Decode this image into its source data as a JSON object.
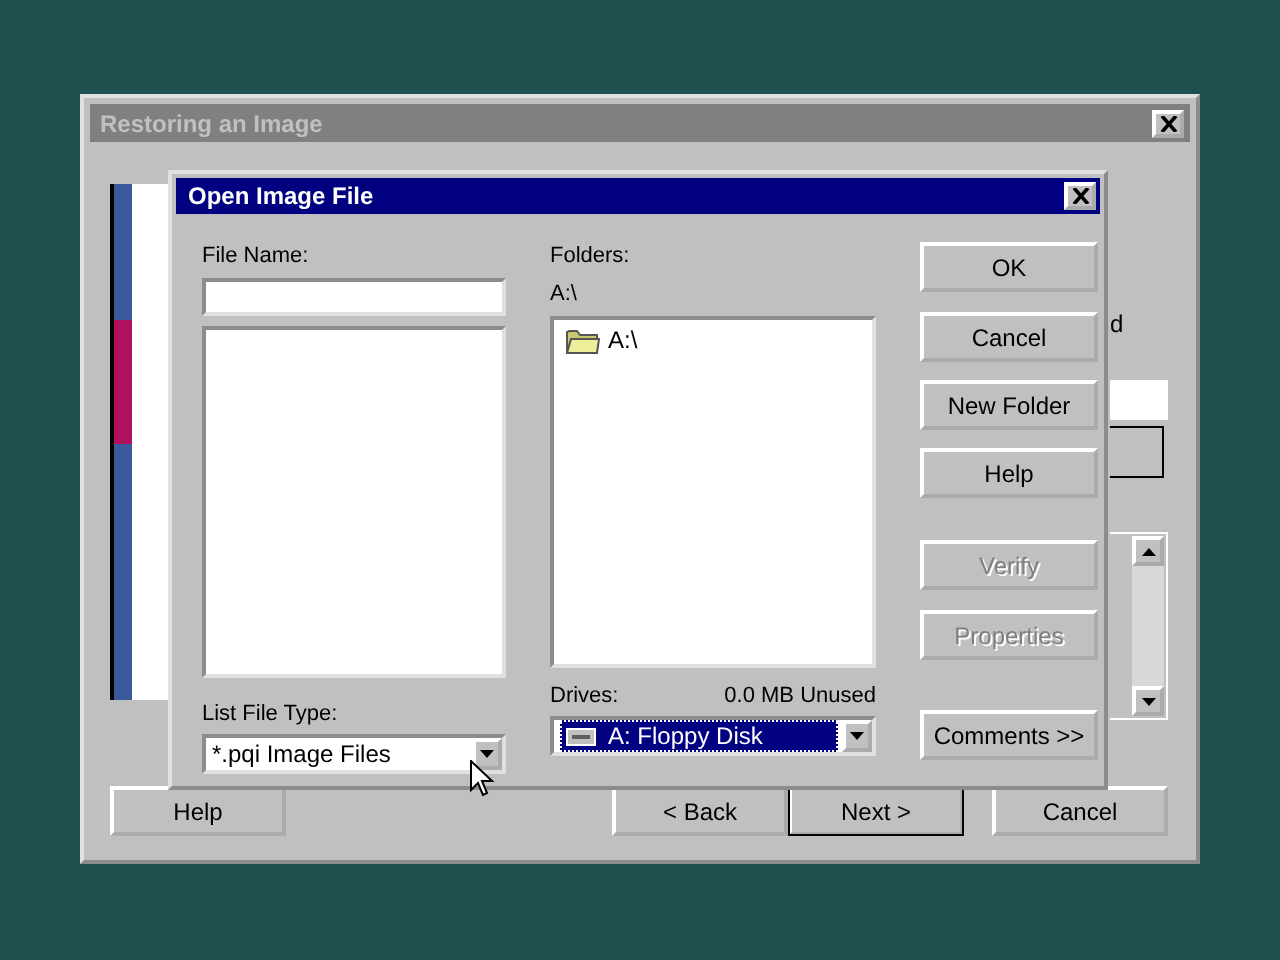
{
  "background_window": {
    "title": "Restoring an Image",
    "fragment_text": "d",
    "buttons": [
      {
        "label": "Help",
        "default": false
      },
      {
        "label": "< Back",
        "default": false
      },
      {
        "label": "Next >",
        "default": true
      },
      {
        "label": "Cancel",
        "default": false
      }
    ]
  },
  "dialog": {
    "title": "Open Image File",
    "file_name": {
      "label": "File Name:"
    },
    "file_type": {
      "label": "List File Type:",
      "value": "*.pqi  Image Files"
    },
    "folders": {
      "label": "Folders:",
      "path": "A:\\",
      "items": [
        {
          "label": "A:\\",
          "selected": false
        }
      ]
    },
    "drives": {
      "label": "Drives:",
      "free": "0.0 MB Unused",
      "value": "A:  Floppy Disk",
      "focused": true
    },
    "buttons": [
      {
        "label": "OK",
        "disabled": false
      },
      {
        "label": "Cancel",
        "disabled": false
      },
      {
        "label": "New Folder",
        "disabled": false
      },
      {
        "label": "Help",
        "disabled": false
      },
      {
        "label": "Verify",
        "disabled": true
      },
      {
        "label": "Properties",
        "disabled": true
      },
      {
        "label": "Comments >>",
        "disabled": false
      }
    ]
  }
}
